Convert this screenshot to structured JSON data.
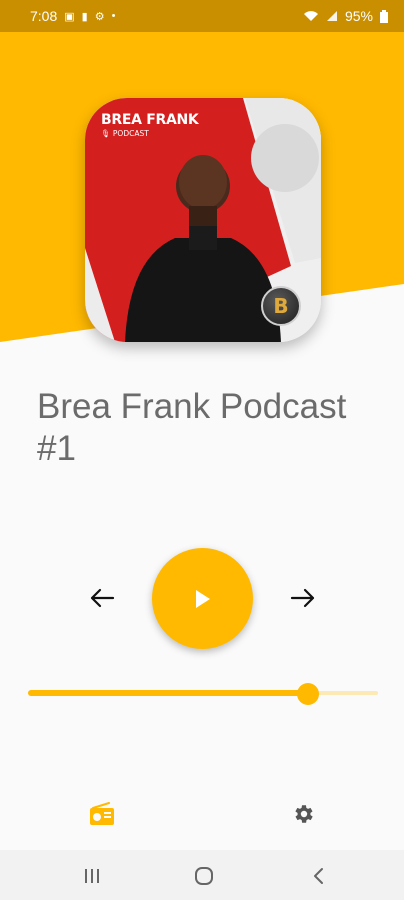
{
  "status_bar": {
    "time": "7:08",
    "battery": "95%",
    "notification_icons": [
      "message-icon",
      "alert-icon",
      "settings-icon",
      "dot-icon"
    ]
  },
  "cover": {
    "title": "BREA FRANK",
    "subtitle": "PODCAST",
    "logo_letter": "B"
  },
  "track": {
    "title": "Brea Frank Podcast #1"
  },
  "player": {
    "progress": 0.8
  },
  "bottom_nav": {
    "items": [
      {
        "icon": "radio-icon",
        "active": true
      },
      {
        "icon": "gear-icon",
        "active": false
      }
    ]
  },
  "colors": {
    "accent": "#ffb900",
    "status_bar": "#c98f00",
    "text": "#6b6b6b"
  }
}
